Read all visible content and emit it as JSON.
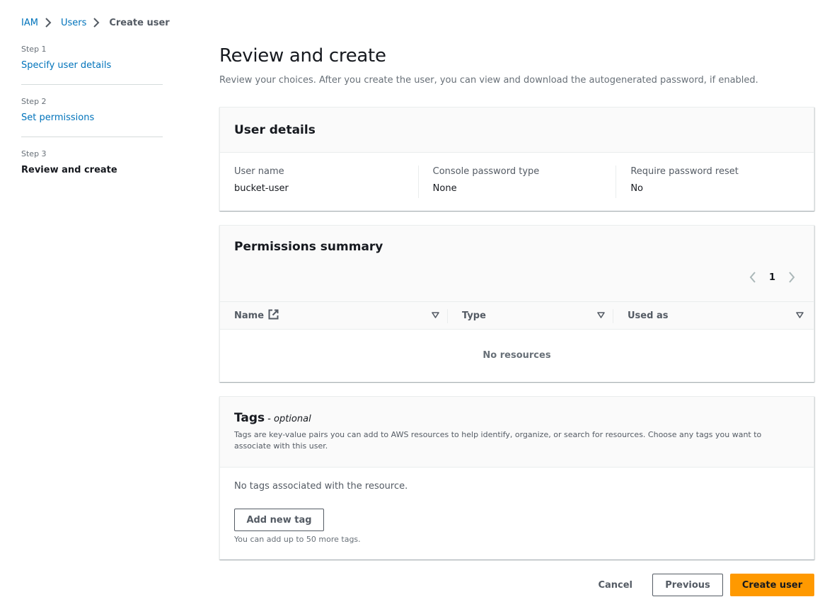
{
  "breadcrumb": {
    "items": [
      {
        "label": "IAM",
        "link": true
      },
      {
        "label": "Users",
        "link": true
      },
      {
        "label": "Create user",
        "link": false
      }
    ]
  },
  "wizard": {
    "steps": [
      {
        "number": "Step 1",
        "label": "Specify user details",
        "active": false
      },
      {
        "number": "Step 2",
        "label": "Set permissions",
        "active": false
      },
      {
        "number": "Step 3",
        "label": "Review and create",
        "active": true
      }
    ]
  },
  "page": {
    "title": "Review and create",
    "description": "Review your choices. After you create the user, you can view and download the autogenerated password, if enabled."
  },
  "user_details": {
    "title": "User details",
    "fields": [
      {
        "label": "User name",
        "value": "bucket-user"
      },
      {
        "label": "Console password type",
        "value": "None"
      },
      {
        "label": "Require password reset",
        "value": "No"
      }
    ]
  },
  "permissions_summary": {
    "title": "Permissions summary",
    "pagination": {
      "current_page": "1",
      "prev_icon": "chevron-left-icon",
      "next_icon": "chevron-right-icon"
    },
    "columns": [
      {
        "label": "Name",
        "icon": "external-link-icon"
      },
      {
        "label": "Type"
      },
      {
        "label": "Used as"
      }
    ],
    "rows": [],
    "empty_text": "No resources"
  },
  "tags": {
    "title": "Tags",
    "optional_label": "- optional",
    "description": "Tags are key-value pairs you can add to AWS resources to help identify, organize, or search for resources. Choose any tags you want to associate with this user.",
    "empty_text": "No tags associated with the resource.",
    "add_button_label": "Add new tag",
    "hint": "You can add up to 50 more tags."
  },
  "footer": {
    "cancel_label": "Cancel",
    "previous_label": "Previous",
    "create_label": "Create user"
  },
  "colors": {
    "link": "#0073bb",
    "primary_button": "#ff9900",
    "text": "#16191f",
    "muted": "#545b64"
  }
}
